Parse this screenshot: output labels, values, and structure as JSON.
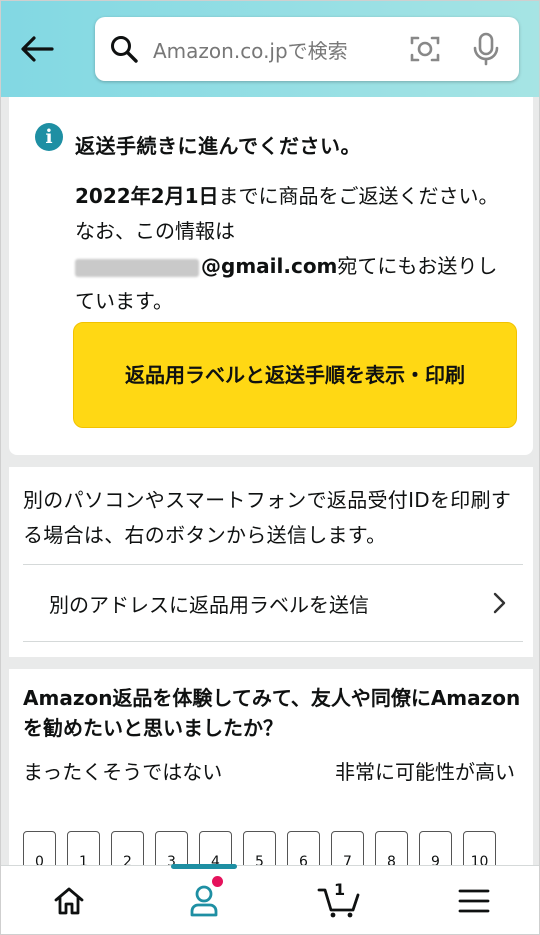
{
  "header": {
    "search_placeholder": "Amazon.co.jpで検索",
    "icons": [
      "back-arrow-icon",
      "search-icon",
      "camera-icon",
      "microphone-icon"
    ]
  },
  "notice": {
    "title": "返送手続きに進んでください。",
    "deadline": "2022年2月1日",
    "body_1": "までに商品をご返送ください。なお、この情報は",
    "email_domain": "@gmail.com",
    "body_2": "宛てにもお送りしています。",
    "print_button": "返品用ラベルと返送手順を表示・印刷"
  },
  "alt_send": {
    "description": "別のパソコンやスマートフォンで返品受付IDを印刷する場合は、右のボタンから送信します。",
    "send_link": "別のアドレスに返品用ラベルを送信"
  },
  "survey": {
    "question": "Amazon返品を体験してみて、友人や同僚にAmazonを勧めたいと思いましたか？",
    "low_label": "まったくそうではない",
    "high_label": "非常に可能性が高い",
    "scale": [
      "0",
      "1",
      "2",
      "3",
      "4",
      "5",
      "6",
      "7",
      "8",
      "9",
      "10"
    ]
  },
  "bottom_nav": {
    "items": [
      "home",
      "account",
      "cart",
      "menu"
    ],
    "cart_count": "1",
    "active": "account"
  },
  "colors": {
    "header_gradient_start": "#82d8e3",
    "header_gradient_end": "#a6e4e4",
    "primary_button": "#ffd814",
    "info_icon": "#1e8fa3",
    "active_indicator": "#1e8fa3",
    "notification_dot": "#e5125c"
  }
}
